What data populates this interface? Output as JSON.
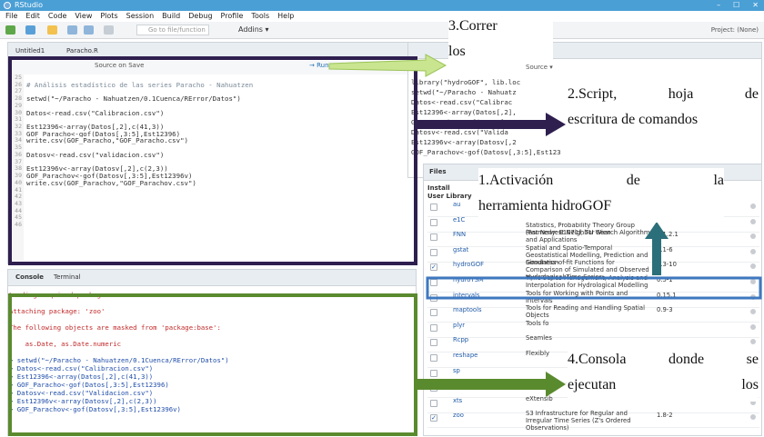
{
  "window": {
    "title": "RStudio",
    "controls": [
      "–",
      "☐",
      "✕"
    ]
  },
  "menu": [
    "File",
    "Edit",
    "Code",
    "View",
    "Plots",
    "Session",
    "Build",
    "Debug",
    "Profile",
    "Tools",
    "Help"
  ],
  "toolbar": {
    "goto_placeholder": "Go to file/function",
    "addins": "Addins ▾",
    "project": "Project: (None)"
  },
  "editor": {
    "tabs": [
      "Untitled1",
      "Paracho.R"
    ],
    "source_on_save": "Source on Save",
    "run": "→ Run",
    "source": "→ Source ▾",
    "line_numbers": [
      "25",
      "26",
      "27",
      "28",
      "29",
      "30",
      "31",
      "32",
      "33",
      "34",
      "35",
      "36",
      "37",
      "38",
      "39",
      "40",
      "41",
      "42",
      "43",
      "44",
      "45",
      "46"
    ],
    "lines": [
      "",
      "# Análisis estadístico de las series Paracho - Nahuatzen",
      "",
      "setwd(\"~/Paracho - Nahuatzen/0.1Cuenca/RError/Datos\")",
      "",
      "Datos<-read.csv(\"Calibracion.csv\")",
      "",
      "Est12396<-array(Datos[,2],c(41,3))",
      "GOF_Paracho<-gof(Datos[,3:5],Est12396)",
      "write.csv(GOF_Paracho,\"GOF_Paracho.csv\")",
      "",
      "Datosv<-read.csv(\"validacion.csv\")",
      "",
      "Est12396v<-array(Datosv[,2],c(2,3))",
      "GOF_Parachov<-gof(Datosv[,3:5],Est12396v)",
      "write.csv(GOF_Parachov,\"GOF_Parachov.csv\")",
      "",
      "",
      "",
      "",
      "",
      ""
    ]
  },
  "console": {
    "tabs": [
      "Console",
      "Terminal"
    ],
    "lines": [
      {
        "text": "Loading required package: zoo",
        "color": "red"
      },
      {
        "text": "",
        "color": "red"
      },
      {
        "text": "Attaching package: 'zoo'",
        "color": "red"
      },
      {
        "text": "",
        "color": "red"
      },
      {
        "text": "The following objects are masked from 'package:base':",
        "color": "red"
      },
      {
        "text": "",
        "color": "red"
      },
      {
        "text": "    as.Date, as.Date.numeric",
        "color": "red"
      },
      {
        "text": "",
        "color": "blue"
      },
      {
        "text": "> setwd(\"~/Paracho - Nahuatzen/0.1Cuenca/RError/Datos\")",
        "color": "blue"
      },
      {
        "text": "> Datos<-read.csv(\"Calibracion.csv\")",
        "color": "blue"
      },
      {
        "text": "> Est12396<-array(Datos[,2],c(41,3))",
        "color": "blue"
      },
      {
        "text": "> GOF_Paracho<-gof(Datos[,3:5],Est12396)",
        "color": "blue"
      },
      {
        "text": "> Datosv<-read.csv(\"Validacion.csv\")",
        "color": "blue"
      },
      {
        "text": "> Est12396v<-array(Datosv[,2],c(2,3))",
        "color": "blue"
      },
      {
        "text": "> GOF_Parachov<-gof(Datosv[,3:5],Est12396v)",
        "color": "blue"
      }
    ]
  },
  "environment": {
    "source_label": "Source ▾",
    "lines": [
      "library(\"hydroGOF\", lib.loc",
      "setwd(\"~/Paracho - Nahuatz",
      "Datos<-read.csv(\"Calibrac",
      "Est12396<-array(Datos[,2],",
      "GOF_Paracho<-gof(Datos[,3",
      "Datosv<-read.csv(\"Valida",
      "Est12396v<-array(Datosv[,2",
      "GOF_Parachov<-gof(Datosv[,3:5],Est12396v)"
    ]
  },
  "packages": {
    "tabs": [
      "Files",
      "Plots",
      "Packages",
      "Help",
      "Viewer"
    ],
    "install": "Install",
    "header": "User Library",
    "rows": [
      {
        "name": "au",
        "desc": "",
        "ver": "",
        "checked": false
      },
      {
        "name": "e1C",
        "desc": "Misc Functions of the Department of Statistics, Probability Theory Group (Formerly: E1071), TU Wien",
        "ver": "1.7-0",
        "checked": false
      },
      {
        "name": "FNN",
        "desc": "Fast Nearest Neighbor Search Algorithms and Applications",
        "ver": "1.1.2.1",
        "checked": false
      },
      {
        "name": "gstat",
        "desc": "Spatial and Spatio-Temporal Geostatistical Modelling, Prediction and Simulation",
        "ver": "1.1-6",
        "checked": false
      },
      {
        "name": "hydroGOF",
        "desc": "Goodness-of-fit Functions for Comparison of Simulated and Observed Hydrological Time Series",
        "ver": "0.3-10",
        "checked": true
      },
      {
        "name": "hydroTSM",
        "desc": "Time Series Management, Analysis and Interpolation for Hydrological Modelling",
        "ver": "0.5-1",
        "checked": false
      },
      {
        "name": "intervals",
        "desc": "Tools for Working with Points and Intervals",
        "ver": "0.15.1",
        "checked": false
      },
      {
        "name": "maptools",
        "desc": "Tools for Reading and Handling Spatial Objects",
        "ver": "0.9-3",
        "checked": false
      },
      {
        "name": "plyr",
        "desc": "Tools fo",
        "ver": "",
        "checked": false
      },
      {
        "name": "Rcpp",
        "desc": "Seamles",
        "ver": "",
        "checked": false
      },
      {
        "name": "reshape",
        "desc": "Flexibly",
        "ver": "",
        "checked": false
      },
      {
        "name": "sp",
        "desc": "",
        "ver": "",
        "checked": false
      },
      {
        "name": "spacetime",
        "desc": "",
        "ver": "",
        "checked": false
      },
      {
        "name": "xts",
        "desc": "eXtensib",
        "ver": "",
        "checked": false
      },
      {
        "name": "zoo",
        "desc": "S3 Infrastructure for Regular and Irregular Time Series (Z's Ordered Observations)",
        "ver": "1.8-2",
        "checked": true
      }
    ]
  },
  "callouts": {
    "run": [
      "3.Correr",
      "los"
    ],
    "script": [
      "2.Script,",
      "hoja",
      "de",
      "escritura de comandos"
    ],
    "activation": [
      "1.Activación",
      "de",
      "la",
      "herramienta hidroGOF"
    ],
    "console": [
      "4.Consola",
      "donde",
      "se",
      "ejecutan",
      "los"
    ]
  },
  "colors": {
    "frame_dark": "#2e1f4f",
    "frame_green": "#5a8a2e",
    "frame_blue": "#3f78c0",
    "arrow_light": "#c9e58f",
    "arrow_dark": "#2e1f4f",
    "arrow_green": "#5a8a2e",
    "arrow_teal": "#2b6f7a"
  }
}
